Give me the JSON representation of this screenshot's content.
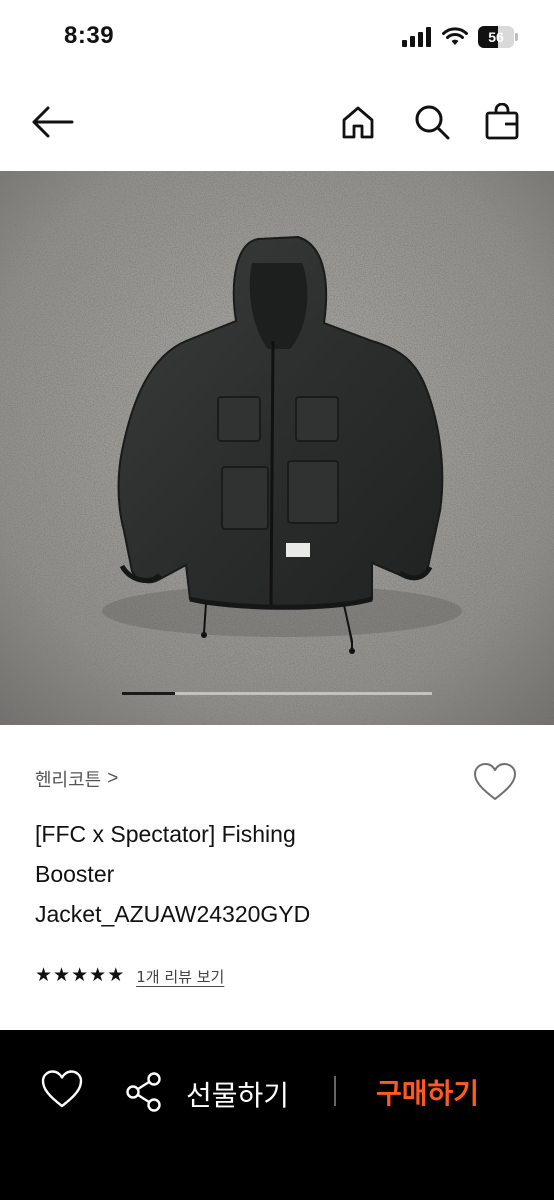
{
  "status_bar": {
    "time": "8:39",
    "battery_level": "56",
    "icons": [
      "signal-icon",
      "wifi-icon",
      "battery-icon"
    ]
  },
  "nav": {
    "icons": [
      "back-arrow-icon",
      "home-icon",
      "search-icon",
      "shopping-bag-icon"
    ]
  },
  "product": {
    "image_carousel": {
      "active_index": 0,
      "progress_fraction": 0.17
    },
    "brand": "헨리코튼",
    "brand_chevron": ">",
    "title_lines": [
      "[FFC x Spectator] Fishing",
      "Booster",
      "Jacket_AZUAW24320GYD"
    ],
    "rating_stars": 5,
    "review_link": "1개 리뷰 보기"
  },
  "bottom_bar": {
    "gift_label": "선물하기",
    "buy_label": "구매하기"
  },
  "colors": {
    "accent": "#ff5a1f",
    "bottom_bar_bg": "#000000",
    "text_primary": "#111111",
    "text_secondary": "#555555"
  }
}
